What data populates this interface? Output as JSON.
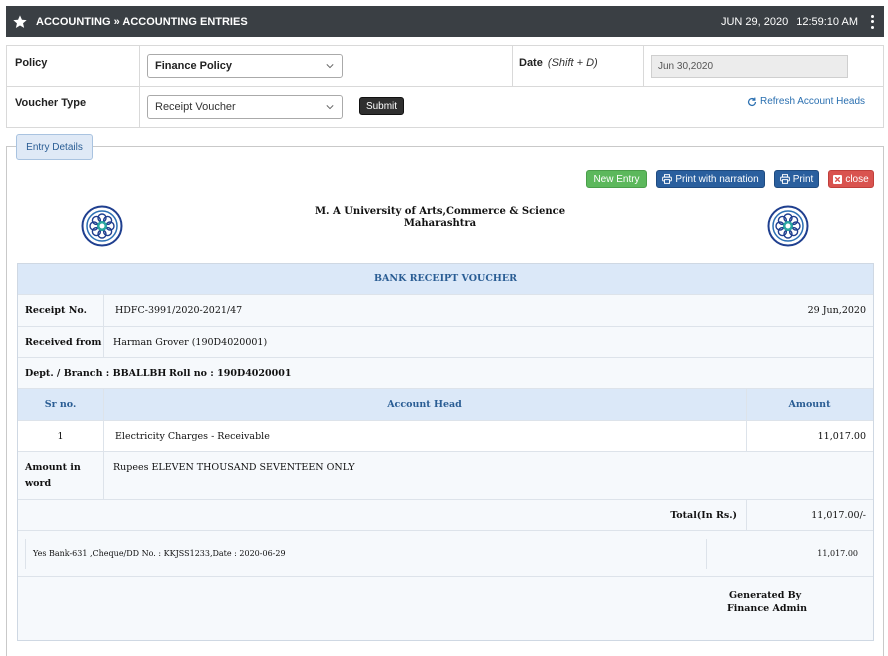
{
  "header": {
    "title": "ACCOUNTING » ACCOUNTING ENTRIES",
    "date": "JUN 29, 2020",
    "time": "12:59:10 AM"
  },
  "form": {
    "policy_label": "Policy",
    "policy_value": "Finance Policy",
    "date_label": "Date",
    "date_hint": "(Shift + D)",
    "date_value": "Jun 30,2020",
    "voucher_type_label": "Voucher Type",
    "voucher_type_value": "Receipt Voucher",
    "submit_label": "Submit",
    "refresh_label": "Refresh Account Heads"
  },
  "entry": {
    "tab_label": "Entry Details",
    "new_entry_label": "New Entry",
    "print_narration_label": "Print with narration",
    "print_label": "Print",
    "close_label": "close",
    "university_line1": "M. A University of Arts,Commerce & Science",
    "university_line2": "Maharashtra"
  },
  "voucher": {
    "title": "BANK RECEIPT VOUCHER",
    "receipt_no_label": "Receipt No.",
    "receipt_no": "HDFC-3991/2020-2021/47",
    "receipt_date": "29 Jun,2020",
    "received_from_label": "Received from",
    "received_from": "Harman Grover (190D4020001)",
    "dept_text": "Dept. / Branch : BBALLBH",
    "roll_text": "Roll no : 190D4020001",
    "col_sr": "Sr no.",
    "col_head": "Account Head",
    "col_amount": "Amount",
    "items": [
      {
        "sr": "1",
        "head": "Electricity Charges - Receivable",
        "amount": "11,017.00"
      }
    ],
    "amount_words_label1": "Amount in",
    "amount_words_label2": "word",
    "amount_words": "Rupees ELEVEN THOUSAND SEVENTEEN ONLY",
    "total_label": "Total(In Rs.)",
    "total_value": "11,017.00/-",
    "bank_detail": "Yes Bank-631 ,Cheque/DD No. : KKJSS1233,Date : 2020-06-29",
    "bank_amount": "11,017.00",
    "generated_by_label": "Generated By",
    "generated_by": "Finance Admin"
  },
  "colors": {
    "header_bg": "#3a3f44",
    "accent_blue": "#2a5f9e",
    "success": "#5cb85c",
    "danger": "#d9534f",
    "table_head": "#dbe8f8"
  },
  "icons": {
    "header": "star-icon",
    "menu": "kebab-menu-icon",
    "refresh": "refresh-icon",
    "print": "print-icon",
    "close": "close-icon",
    "logo": "university-emblem-icon"
  }
}
